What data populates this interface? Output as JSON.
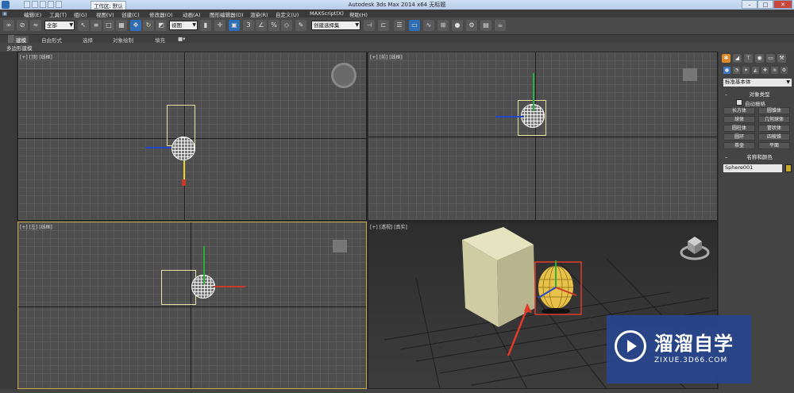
{
  "window": {
    "title": "Autodesk 3ds Max  2014 x64      无标题",
    "quick_access": "工作区: 默认",
    "controls": [
      "–",
      "□",
      "✕"
    ]
  },
  "menu": [
    "编辑(E)",
    "工具(T)",
    "组(G)",
    "视图(V)",
    "创建(C)",
    "修改器(O)",
    "动画(A)",
    "图形编辑器(D)",
    "渲染(R)",
    "自定义(U)",
    "MAXScript(X)",
    "帮助(H)"
  ],
  "toolbar": {
    "selection_filter": "全部",
    "ref_coord": "视图",
    "named_sel": "创建选择集"
  },
  "ribbon": {
    "tabs": [
      "建模",
      "自由形式",
      "选择",
      "对象绘制",
      "填充"
    ],
    "active": 0,
    "sub_label": "多边形建模"
  },
  "viewports": {
    "top": "[+] [顶] [线框]",
    "front": "[+] [前] [线框]",
    "left": "[+] [左] [线框]",
    "persp": "[+] [透视] [真实]"
  },
  "panel": {
    "category": "标准基本体",
    "object_type_header": "对象类型",
    "autogrid": "自动栅格",
    "buttons": [
      "长方体",
      "圆锥体",
      "球体",
      "几何球体",
      "圆柱体",
      "管状体",
      "圆环",
      "四棱锥",
      "茶壶",
      "平面"
    ],
    "name_color_header": "名称和颜色",
    "object_name": "Sphere001",
    "object_color": "#c9a930"
  },
  "watermark": {
    "brand": "溜溜自学",
    "site": "ZIXUE.3D66.COM"
  },
  "colors": {
    "selection_box_red": "#e03a2a",
    "box_object": "#d4d2a8",
    "sphere_selected": "#e8c24a"
  }
}
